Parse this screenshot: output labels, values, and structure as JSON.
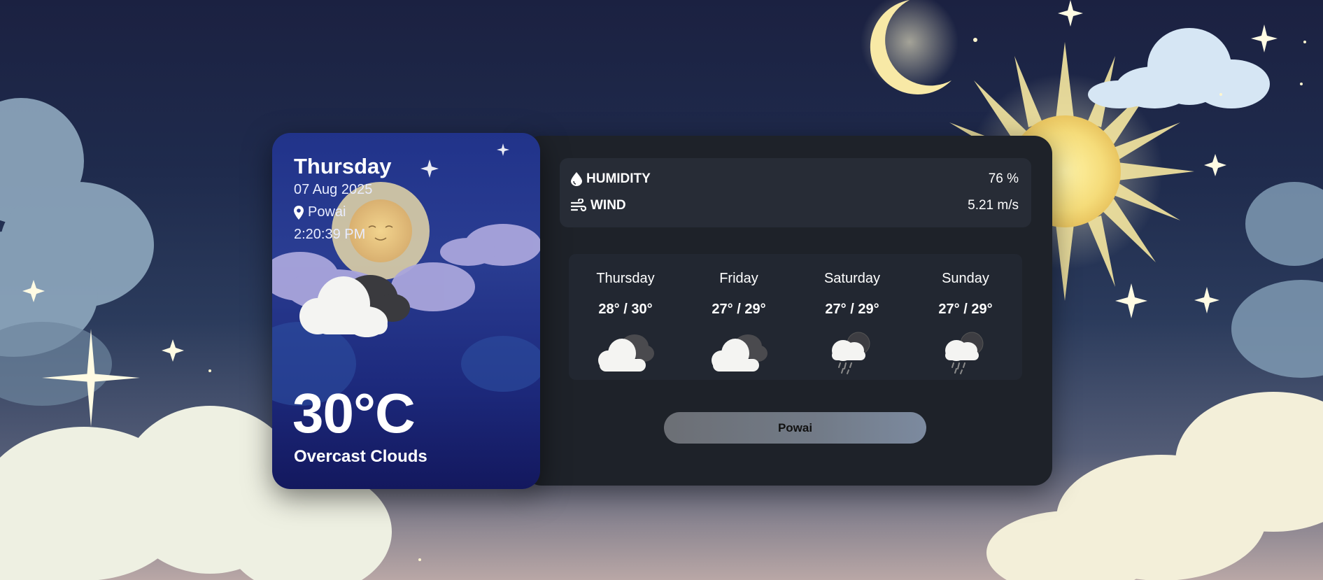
{
  "current": {
    "day": "Thursday",
    "date": "07 Aug 2025",
    "location": "Powai",
    "time": "2:20:39 PM",
    "temperature": "30°C",
    "condition": "Overcast Clouds",
    "icon": "overcast-clouds-icon"
  },
  "stats": {
    "humidity_label": "HUMIDITY",
    "humidity_value": "76 %",
    "humidity_icon": "droplet-icon",
    "wind_label": "WIND",
    "wind_value": "5.21 m/s",
    "wind_icon": "wind-icon"
  },
  "forecast": [
    {
      "day": "Thursday",
      "range": "28° / 30°",
      "icon": "broken-clouds-icon"
    },
    {
      "day": "Friday",
      "range": "27° / 29°",
      "icon": "broken-clouds-icon"
    },
    {
      "day": "Saturday",
      "range": "27° / 29°",
      "icon": "rain-clouds-icon"
    },
    {
      "day": "Sunday",
      "range": "27° / 29°",
      "icon": "rain-clouds-icon"
    }
  ],
  "city_button": {
    "label": "Powai"
  },
  "colors": {
    "panel": "#1e2229",
    "card_top": "#21338a",
    "card_bottom": "#13185e",
    "button": "#727b88"
  }
}
